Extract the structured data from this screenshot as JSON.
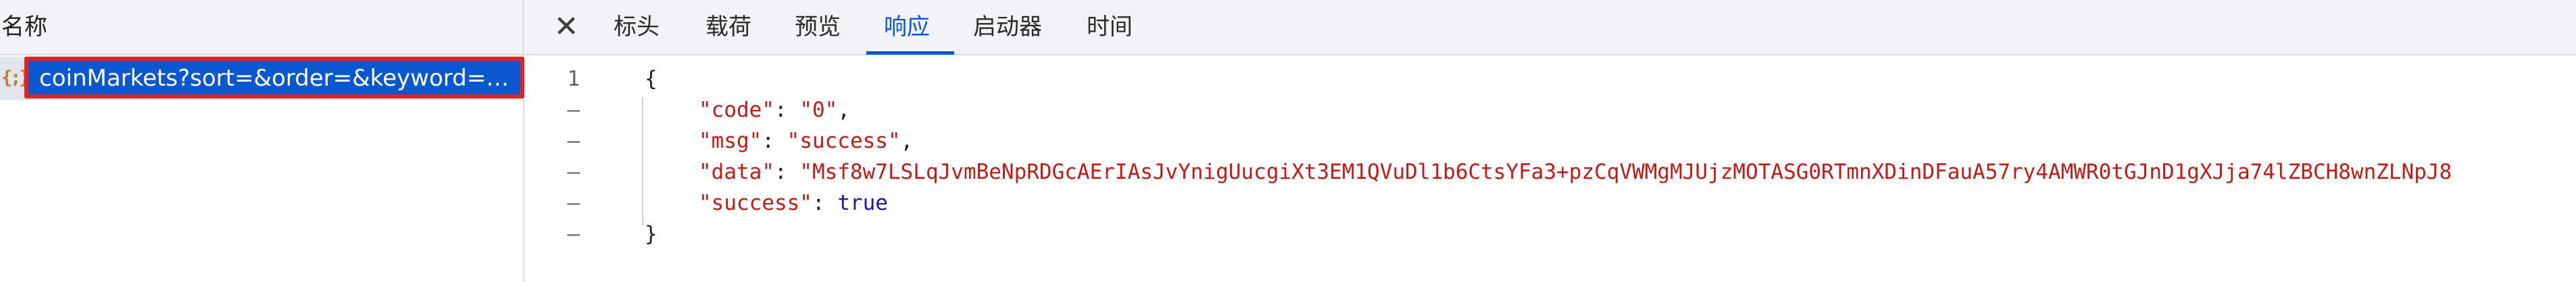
{
  "request_list": {
    "column_title": "名称",
    "selected_request": {
      "type_icon": "{;}",
      "name": "coinMarkets?sort=&order=&keyword=&…"
    }
  },
  "detail": {
    "close_icon": "✕",
    "tabs": [
      {
        "label": "标头",
        "active": false
      },
      {
        "label": "载荷",
        "active": false
      },
      {
        "label": "预览",
        "active": false
      },
      {
        "label": "响应",
        "active": true
      },
      {
        "label": "启动器",
        "active": false
      },
      {
        "label": "时间",
        "active": false
      }
    ],
    "response": {
      "gutter": [
        "1",
        "–",
        "–",
        "–",
        "–",
        "–"
      ],
      "lines": {
        "open": "{",
        "code_key": "\"code\"",
        "code_val": "\"0\"",
        "msg_key": "\"msg\"",
        "msg_val": "\"success\"",
        "data_key": "\"data\"",
        "data_val": "\"Msf8w7LSLqJvmBeNpRDGcAErIAsJvYnigUucgiXt3EM1QVuDl1b6CtsYFa3+pzCqVWMgMJUjzMOTASG0RTmnXDinDFauA57ry4AMWR0tGJnD1gXJja74lZBCH8wnZLNpJ8",
        "success_key": "\"success\"",
        "success_val": "true",
        "close": "}"
      }
    }
  },
  "colors": {
    "accent": "#0b57d0",
    "highlight_border": "#e02424",
    "string": "#c41a16",
    "boolean": "#1a1aa6"
  }
}
